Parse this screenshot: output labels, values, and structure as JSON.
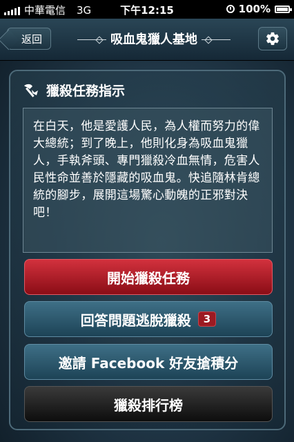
{
  "status_bar": {
    "carrier": "中華電信",
    "network": "3G",
    "time": "下午12:15",
    "battery": "100%"
  },
  "navbar": {
    "back_label": "返回",
    "title": "吸血鬼獵人基地",
    "settings_icon": "gear-icon"
  },
  "panel": {
    "icon": "axe-icon",
    "title": "獵殺任務指示",
    "mission_text": "在白天，他是愛護人民，為人權而努力的偉大總統；到了晚上，他則化身為吸血鬼獵人，手執斧頭、專門獵殺冷血無情，危害人民性命並善於隱藏的吸血鬼。快追隨林肯總統的腳步，展開這場驚心動魄的正邪對決吧！"
  },
  "buttons": {
    "start": "開始獵殺任務",
    "quiz": "回答問題逃脫獵殺",
    "quiz_badge": "3",
    "invite": "邀請 Facebook 好友搶積分",
    "ranking": "獵殺排行榜"
  },
  "colors": {
    "start_button": "#b31d28",
    "blue_button": "#2d5a70",
    "ranking_button": "#1a1a1a",
    "badge": "#9c1a22"
  }
}
